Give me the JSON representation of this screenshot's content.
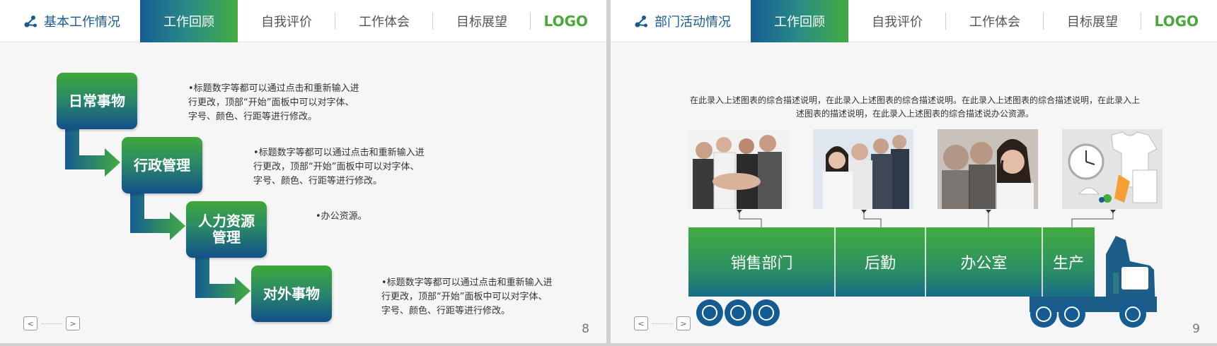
{
  "slides": [
    {
      "brand_title": "基本工作情况",
      "nav": [
        "工作回顾",
        "自我评价",
        "工作体会",
        "目标展望"
      ],
      "active_nav": 0,
      "logo": "LOGO",
      "page_number": "8",
      "pager": {
        "prev": "<",
        "next": ">"
      },
      "steps": [
        {
          "label": "日常事物",
          "text": "•标题数字等都可以通过点击和重新输入进\n行更改，顶部“开始”面板中可以对字体、\n字号、颜色、行距等进行修改。"
        },
        {
          "label": "行政管理",
          "text": "•标题数字等都可以通过点击和重新输入进\n行更改，顶部“开始”面板中可以对字体、\n字号、颜色、行距等进行修改。"
        },
        {
          "label": "人力资源\n管理",
          "text": "•办公资源。"
        },
        {
          "label": "对外事物",
          "text": "•标题数字等都可以通过点击和重新输入进\n行更改，顶部“开始”面板中可以对字体、\n字号、颜色、行距等进行修改。"
        }
      ]
    },
    {
      "brand_title": "部门活动情况",
      "nav": [
        "工作回顾",
        "自我评价",
        "工作体会",
        "目标展望"
      ],
      "active_nav": 0,
      "logo": "LOGO",
      "page_number": "9",
      "pager": {
        "prev": "<",
        "next": ">"
      },
      "intro": "在此录入上述图表的综合描述说明，在此录入上述图表的综合描述说明。在此录入上述图表的综合描述说明，在此录入上述图表的描述说明，在此录入上述图表的综合描述说办公资源。",
      "departments": [
        "销售部门",
        "后勤",
        "办公室",
        "生产"
      ]
    }
  ],
  "colors": {
    "navy": "#155c92",
    "green": "#43ac3f",
    "text": "#333333"
  },
  "icons": {
    "brand": "molecule-icon",
    "photos": [
      "team-hands-photo",
      "business-group-photo",
      "call-center-photo",
      "brand-merchandise-photo"
    ]
  }
}
